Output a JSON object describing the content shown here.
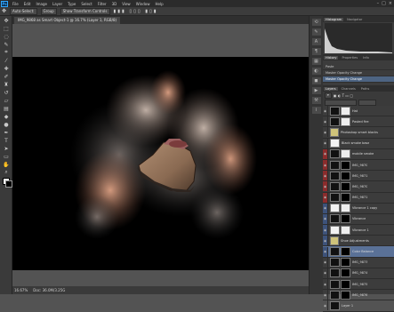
{
  "app": {
    "logo": "Ps"
  },
  "menu": [
    "File",
    "Edit",
    "Image",
    "Layer",
    "Type",
    "Select",
    "Filter",
    "3D",
    "View",
    "Window",
    "Help"
  ],
  "options": {
    "items": [
      "Auto-Select:",
      "Group",
      "Show Transform Controls"
    ]
  },
  "document": {
    "tab_title": "IMG_9868 as Smart Object-1 @ 16.7% (Layer 1, RGB/8)",
    "zoom": "16.67%",
    "doc_info": "Doc: 36.0M/3.25G"
  },
  "panels": {
    "top_tabs": [
      "Histogram",
      "Navigator"
    ],
    "history_tabs": [
      "History",
      "Properties",
      "Info"
    ],
    "history_items": [
      "Paste",
      "Master Opacity Change",
      "Master Opacity Change"
    ],
    "layers_tabs": [
      "Layers",
      "Channels",
      "Paths"
    ],
    "layers": [
      {
        "name": "Hat",
        "color": "none",
        "thumb": "dark",
        "mask": "white"
      },
      {
        "name": "Pasted fire",
        "color": "none",
        "thumb": "dark",
        "mask": "white"
      },
      {
        "name": "Photoshop smart blacks",
        "color": "none",
        "thumb": "group",
        "mask": "none"
      },
      {
        "name": "Black smoke base",
        "color": "none",
        "thumb": "white",
        "mask": "none"
      },
      {
        "name": "mobile smoke",
        "color": "red",
        "thumb": "dark",
        "mask": "white"
      },
      {
        "name": "IMG_9870",
        "color": "red",
        "thumb": "dark",
        "mask": "dark"
      },
      {
        "name": "IMG_9871",
        "color": "red",
        "thumb": "dark",
        "mask": "dark"
      },
      {
        "name": "IMG_9870",
        "color": "red",
        "thumb": "dark",
        "mask": "dark"
      },
      {
        "name": "IMG_9871",
        "color": "red",
        "thumb": "dark",
        "mask": "dark"
      },
      {
        "name": "Vibrance 1 copy",
        "color": "blue",
        "thumb": "white",
        "mask": "white"
      },
      {
        "name": "Vibrance",
        "color": "blue",
        "thumb": "dark",
        "mask": "dark"
      },
      {
        "name": "Vibrance 1",
        "color": "blue",
        "thumb": "white",
        "mask": "white"
      },
      {
        "name": "Shoe Adjustments",
        "color": "blue",
        "thumb": "group",
        "mask": "none"
      },
      {
        "name": "Color Balance",
        "color": "blue",
        "thumb": "dark",
        "mask": "dark"
      },
      {
        "name": "IMG_9873",
        "color": "none",
        "thumb": "dark",
        "mask": "dark"
      },
      {
        "name": "IMG_9874",
        "color": "none",
        "thumb": "dark",
        "mask": "dark"
      },
      {
        "name": "IMG_9875",
        "color": "none",
        "thumb": "dark",
        "mask": "dark"
      },
      {
        "name": "IMG_9876",
        "color": "none",
        "thumb": "dark",
        "mask": "dark"
      },
      {
        "name": "Layer 1",
        "color": "none",
        "thumb": "dark",
        "mask": "none"
      }
    ],
    "selected_layer_index": 13
  }
}
